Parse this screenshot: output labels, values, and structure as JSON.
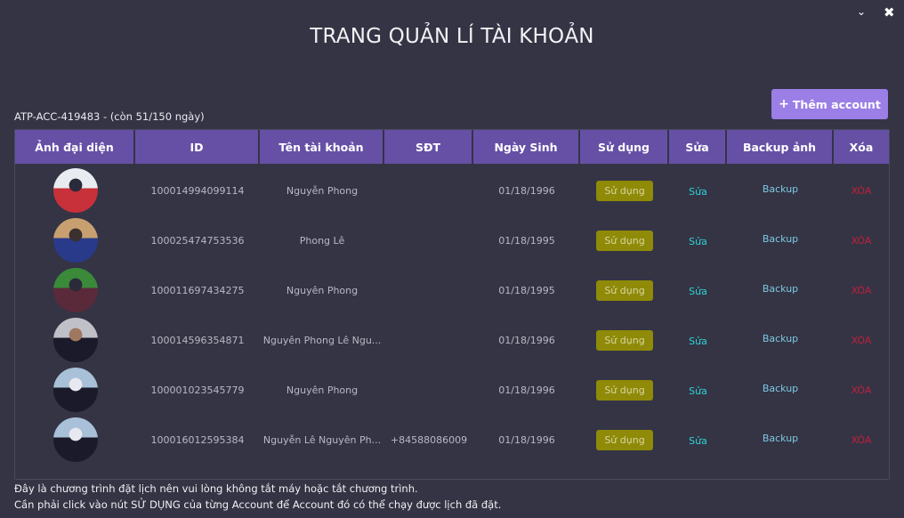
{
  "window": {
    "minimize_icon": "chevron-down-icon",
    "close_icon": "close-icon",
    "minimize_glyph": "⌄",
    "close_glyph": "✖"
  },
  "header": {
    "title": "TRANG QUẢN LÍ TÀI KHOẢN",
    "license": "ATP-ACC-419483 - (còn 51/150 ngày)",
    "add_button": {
      "icon": "+",
      "label": "Thêm account"
    }
  },
  "table": {
    "columns": [
      "Ảnh đại diện",
      "ID",
      "Tên tài khoản",
      "SĐT",
      "Ngày Sinh",
      "Sử dụng",
      "Sửa",
      "Backup ảnh",
      "Xóa"
    ],
    "rows": [
      {
        "id": "100014994099114",
        "name": "Nguyễn Phong",
        "phone": "",
        "dob": "01/18/1996",
        "use": "Sử dụng",
        "edit": "Sửa",
        "backup": "Backup",
        "delete": "XÓA",
        "avatar_colors": [
          "#e8ecf0",
          "#c8303a",
          "#2a2a3a"
        ]
      },
      {
        "id": "100025474753536",
        "name": "Phong Lê",
        "phone": "",
        "dob": "01/18/1995",
        "use": "Sử dụng",
        "edit": "Sửa",
        "backup": "Backup",
        "delete": "XÓA",
        "avatar_colors": [
          "#c8a070",
          "#2a3a8a",
          "#3a3030"
        ]
      },
      {
        "id": "100011697434275",
        "name": "Nguyên Phong",
        "phone": "",
        "dob": "01/18/1995",
        "use": "Sử dụng",
        "edit": "Sửa",
        "backup": "Backup",
        "delete": "XÓA",
        "avatar_colors": [
          "#3a8a3a",
          "#5a2a3a",
          "#2a2a3a"
        ]
      },
      {
        "id": "100014596354871",
        "name": "Nguyên Phong Lê Ngu...",
        "phone": "",
        "dob": "01/18/1996",
        "use": "Sử dụng",
        "edit": "Sửa",
        "backup": "Backup",
        "delete": "XÓA",
        "avatar_colors": [
          "#c0c0c8",
          "#1a1a2a",
          "#a07860"
        ]
      },
      {
        "id": "100001023545779",
        "name": "Nguyên Phong",
        "phone": "",
        "dob": "01/18/1996",
        "use": "Sử dụng",
        "edit": "Sửa",
        "backup": "Backup",
        "delete": "XÓA",
        "avatar_colors": [
          "#a8c0d8",
          "#1a1a2a",
          "#e8e8f0"
        ]
      },
      {
        "id": "100016012595384",
        "name": "Nguyễn Lê Nguyên Ph...",
        "phone": "+84588086009",
        "dob": "01/18/1996",
        "use": "Sử dụng",
        "edit": "Sửa",
        "backup": "Backup",
        "delete": "XÓA",
        "avatar_colors": [
          "#a8c0d8",
          "#1a1a2a",
          "#e8e8f0"
        ]
      }
    ]
  },
  "footer": {
    "note1": "Đây là chương trình đặt lịch nên vui lòng không tắt máy hoặc tắt chương trình.",
    "note2": "Cần phải click vào nút SỬ DỤNG của từng Account để Account đó có thể chạy được lịch đã đặt."
  },
  "colors": {
    "background": "#343445",
    "header_bg": "#6650a6",
    "accent_button": "#9b7ee6",
    "use_button": "#8f8a07",
    "edit_link": "#2fd3d3",
    "backup_link": "#7ec8e0",
    "delete_link": "#c0203a"
  }
}
